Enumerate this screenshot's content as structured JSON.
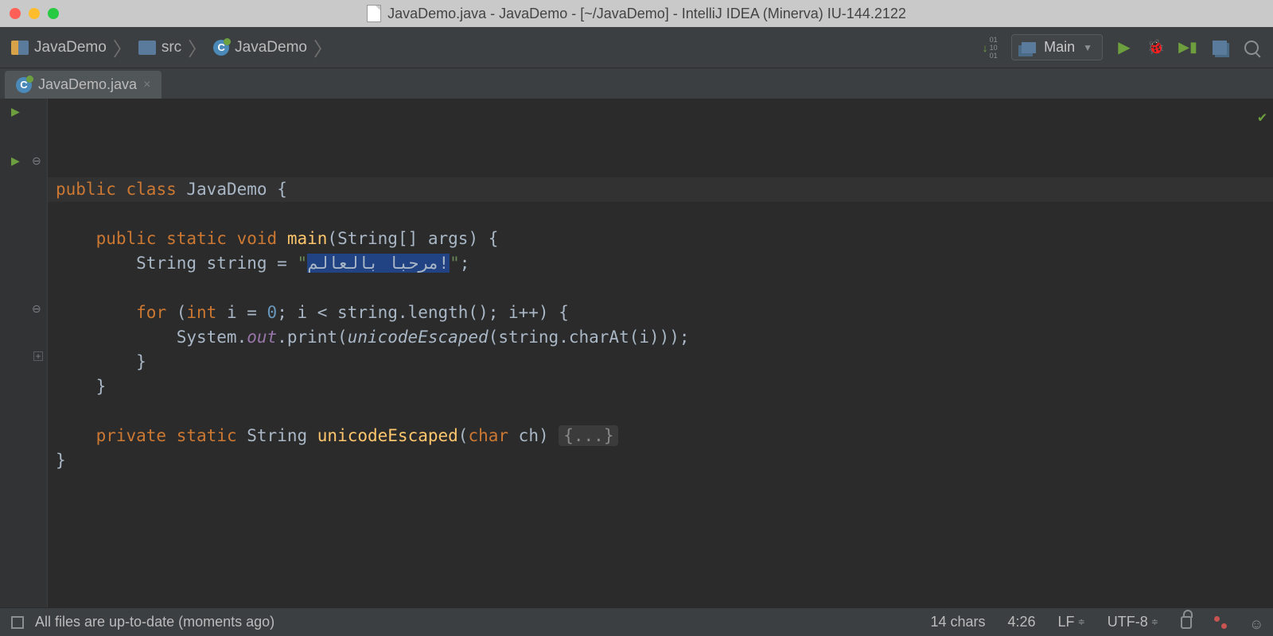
{
  "titlebar": {
    "title": "JavaDemo.java - JavaDemo - [~/JavaDemo] - IntelliJ IDEA (Minerva) IU-144.2122"
  },
  "breadcrumbs": {
    "items": [
      {
        "label": "JavaDemo",
        "icon": "project"
      },
      {
        "label": "src",
        "icon": "folder"
      },
      {
        "label": "JavaDemo",
        "icon": "class"
      }
    ]
  },
  "run_config": {
    "label": "Main"
  },
  "tab": {
    "label": "JavaDemo.java"
  },
  "code": {
    "kw_public": "public",
    "kw_class": "class",
    "class_name": "JavaDemo",
    "brace_open": " {",
    "kw_static": "static",
    "kw_void": "void",
    "main": "main",
    "main_args_open": "(",
    "string_type": "String",
    "main_args_rest": "[] args) {",
    "string_decl": "String string = ",
    "str_quote1": "\"",
    "str_selected": "مرحبا بالعالم!",
    "str_quote2": "\"",
    "semi": ";",
    "kw_for": "for",
    "for_open": " (",
    "kw_int": "int",
    "for_init": " i = ",
    "zero": "0",
    "for_rest": "; i < string.length(); i++) {",
    "system": "System.",
    "out": "out",
    "print_call": ".print(",
    "unicode_escaped": "unicodeEscaped",
    "print_args": "(string.charAt(i)));",
    "brace_close": "}",
    "kw_private": "private",
    "ret_type": "String",
    "method2": "unicodeEscaped",
    "method2_args_open": "(",
    "kw_char": "char",
    "method2_args": " ch) ",
    "folded_text": "{...}"
  },
  "status": {
    "message": "All files are up-to-date (moments ago)",
    "chars": "14 chars",
    "pos": "4:26",
    "line_sep": "LF",
    "encoding": "UTF-8"
  }
}
